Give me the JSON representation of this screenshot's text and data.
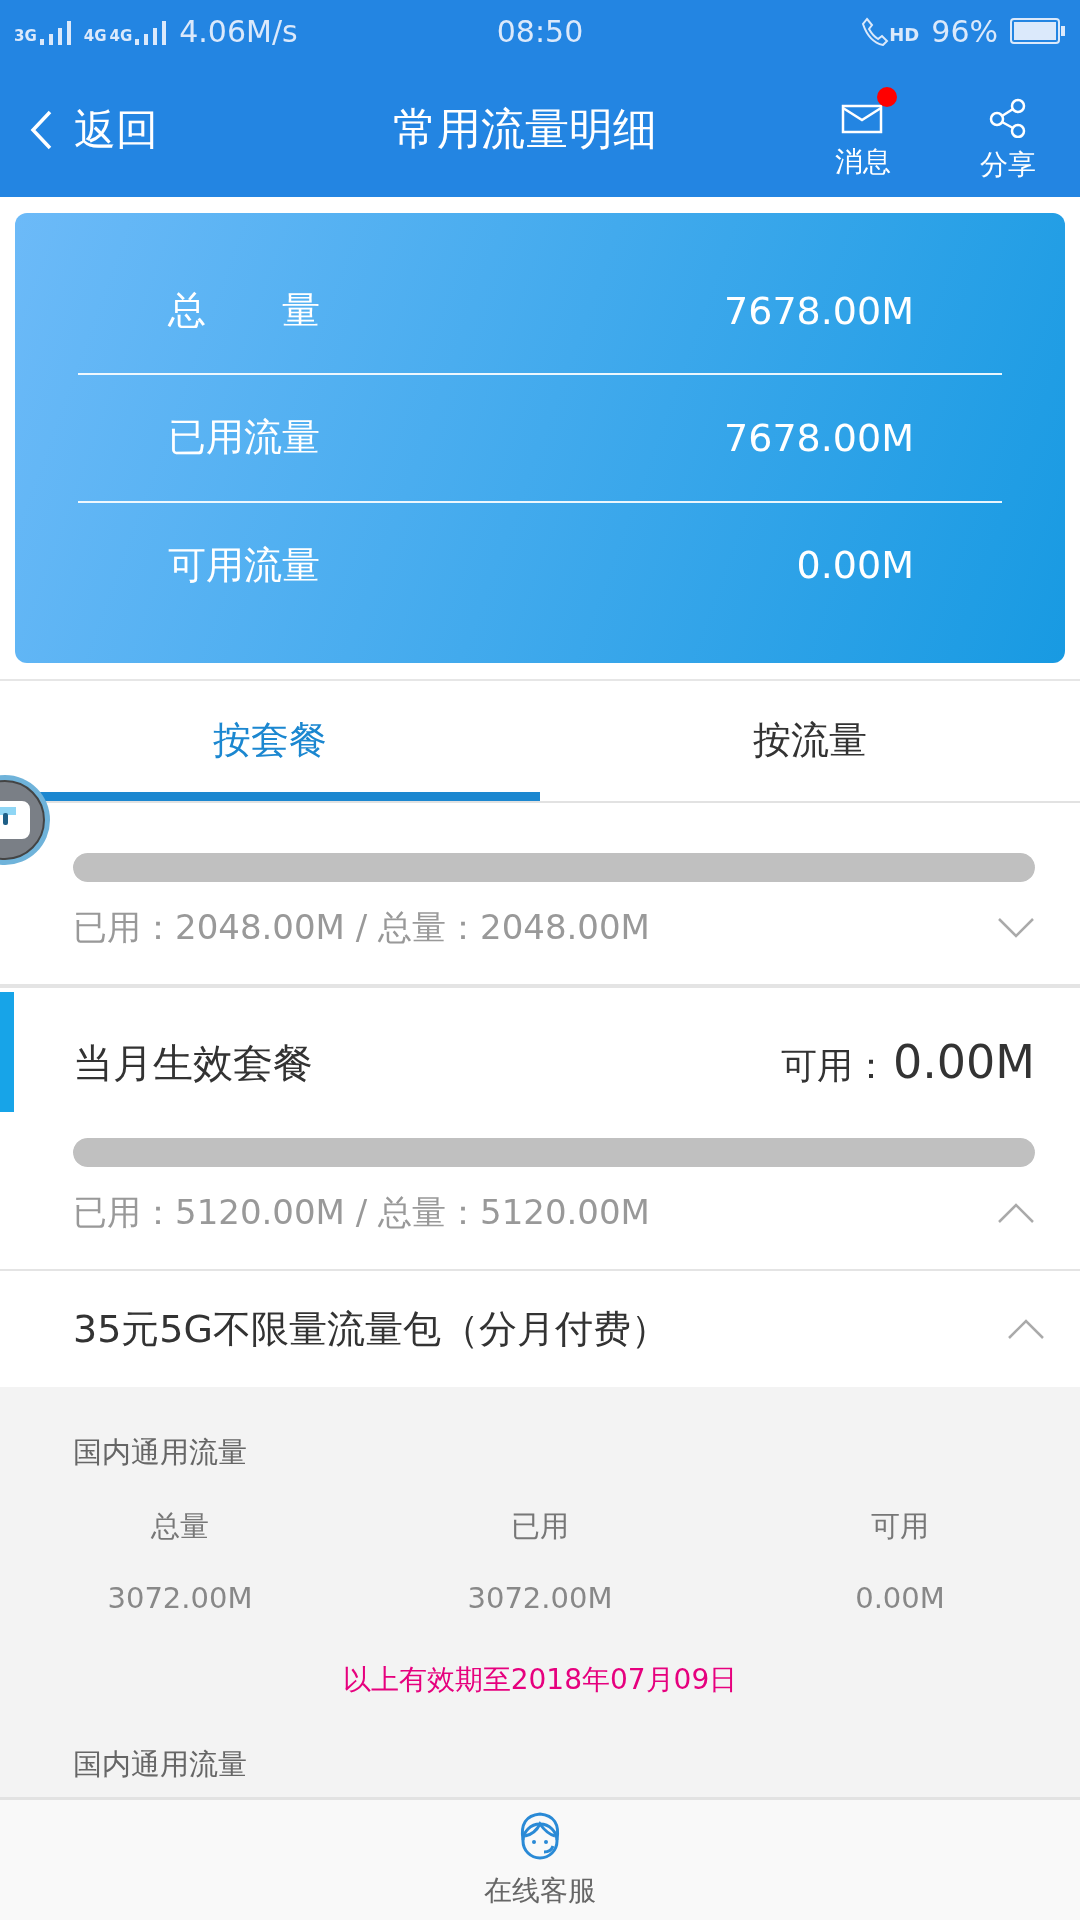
{
  "status_bar": {
    "signal_1": "3G",
    "signal_2": "4G",
    "signal_3": "4G",
    "speed": "4.06M/s",
    "time": "08:50",
    "call_badge": "HD",
    "battery": "96%"
  },
  "nav": {
    "back": "返回",
    "title": "常用流量明细",
    "actions": [
      {
        "kind": "mail",
        "label": "消息",
        "unread": true
      },
      {
        "kind": "share",
        "label": "分享"
      }
    ]
  },
  "summary": [
    {
      "label": "总　　量",
      "value": "7678.00M"
    },
    {
      "label": "已用流量",
      "value": "7678.00M"
    },
    {
      "label": "可用流量",
      "value": "0.00M"
    }
  ],
  "tabs": [
    {
      "label": "按套餐",
      "selected": true
    },
    {
      "label": "按流量",
      "selected": false
    }
  ],
  "plans": [
    {
      "selected": false,
      "level": 1,
      "usage": "已用：2048.00M / 总量：2048.00M",
      "expanded": false
    },
    {
      "selected": true,
      "title": "当月生效套餐",
      "available_label": "可用：",
      "available": "0.00M",
      "level": 1,
      "usage": "已用：5120.00M / 总量：5120.00M",
      "expanded": true
    }
  ],
  "package": {
    "name": "35元5G不限量流量包（分月付费）",
    "expanded": true,
    "groups": [
      {
        "title": "国内通用流量",
        "columns": [
          {
            "label": "总量",
            "value": "3072.00M"
          },
          {
            "label": "已用",
            "value": "3072.00M"
          },
          {
            "label": "可用",
            "value": "0.00M"
          }
        ],
        "validity": "以上有效期至2018年07月09日"
      },
      {
        "title": "国内通用流量"
      }
    ]
  },
  "bottom_bar": {
    "label": "在线客服"
  }
}
